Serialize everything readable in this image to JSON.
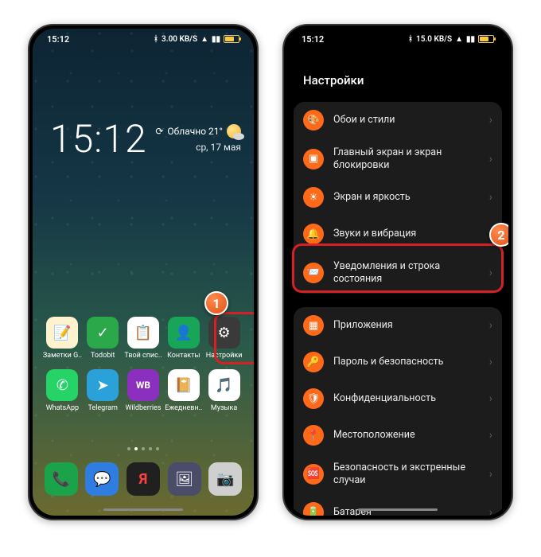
{
  "statusbar": {
    "time": "15:12",
    "speed": "3.00 KB/S",
    "speed2": "15.0 KB/S"
  },
  "home": {
    "clock": "15:12",
    "weather_text": "Облачно 21°",
    "date": "ср, 17 мая",
    "apps_row1": [
      {
        "label": "Заметки G..",
        "bg": "#fff3cf",
        "glyph": "📝"
      },
      {
        "label": "Todobit",
        "bg": "#2aa84a",
        "glyph": "✓"
      },
      {
        "label": "Твой спис..",
        "bg": "#ffffff",
        "glyph": "📋"
      },
      {
        "label": "Контакты",
        "bg": "#18a558",
        "glyph": "👤"
      },
      {
        "label": "Настройки",
        "bg": "#3a3a3a",
        "glyph": "⚙"
      }
    ],
    "apps_row2": [
      {
        "label": "WhatsApp",
        "bg": "#25d366",
        "glyph": "✆"
      },
      {
        "label": "Telegram",
        "bg": "#2aa1d8",
        "glyph": "➤"
      },
      {
        "label": "Wildberries",
        "bg": "#8b2fbf",
        "glyph": "WB"
      },
      {
        "label": "Ежедневн..",
        "bg": "#ffffff",
        "glyph": "📔"
      },
      {
        "label": "Музыка",
        "bg": "#ffffff",
        "glyph": "🎵"
      }
    ],
    "dock": [
      {
        "bg": "#1aa34a",
        "glyph": "📞"
      },
      {
        "bg": "#2f7de1",
        "glyph": "💬"
      },
      {
        "bg": "#202020",
        "glyph": "Я"
      },
      {
        "bg": "#4b4b6a",
        "glyph": "🖼"
      },
      {
        "bg": "#cfcfcf",
        "glyph": "📷"
      }
    ]
  },
  "settings": {
    "title": "Настройки",
    "group1": [
      {
        "glyph": "🎨",
        "label": "Обои и стили"
      },
      {
        "glyph": "▣",
        "label": "Главный экран и экран блокировки"
      },
      {
        "glyph": "☀",
        "label": "Экран и яркость"
      },
      {
        "glyph": "🔔",
        "label": "Звуки и вибрация"
      },
      {
        "glyph": "📨",
        "label": "Уведомления и строка состояния"
      }
    ],
    "group2": [
      {
        "glyph": "▦",
        "label": "Приложения"
      },
      {
        "glyph": "🔑",
        "label": "Пароль и безопасность"
      },
      {
        "glyph": "🛡",
        "label": "Конфиденциальность"
      },
      {
        "glyph": "📍",
        "label": "Местоположение"
      },
      {
        "glyph": "🆘",
        "label": "Безопасность и экстренные случаи"
      },
      {
        "glyph": "🔋",
        "label": "Батарея"
      }
    ]
  },
  "markers": {
    "one": "1",
    "two": "2"
  }
}
